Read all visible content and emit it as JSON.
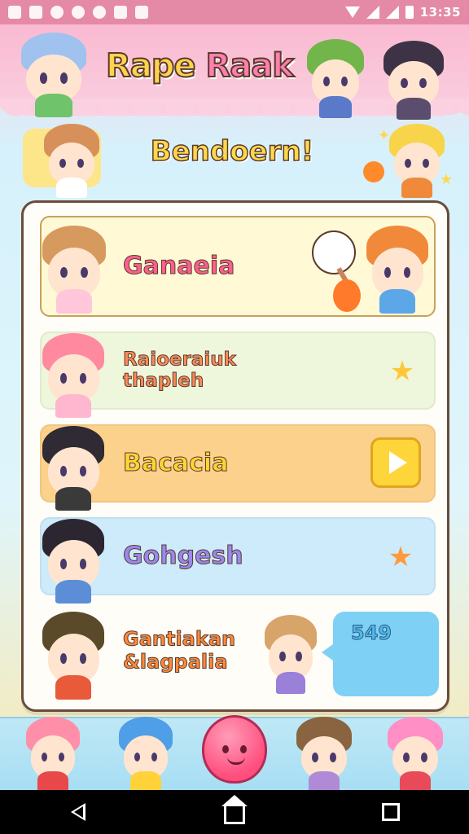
{
  "status_bar": {
    "time": "13:35",
    "icons": [
      "image-icon",
      "notification-icon",
      "alert-icon",
      "compass-icon",
      "record-icon",
      "usb-icon",
      "accessibility-icon",
      "wifi-icon",
      "signal-icon",
      "battery-icon"
    ]
  },
  "header": {
    "title_parts": [
      "Rape",
      " ",
      "Raak"
    ]
  },
  "banner": {
    "title": "Bendoern!"
  },
  "list": {
    "items": [
      {
        "label_line1": "Ganaeia",
        "label_line2": "",
        "accessory": "microphone-icon"
      },
      {
        "label_line1": "Raioeraiuk",
        "label_line2": "thapleh",
        "accessory": "star-icon"
      },
      {
        "label_line1": "Bacacia",
        "label_line2": "",
        "accessory": "play-button"
      },
      {
        "label_line1": "Gohgesh",
        "label_line2": "",
        "accessory": "star-icon"
      },
      {
        "label_line1": "Gantiakan",
        "label_line2": "&lagpalia",
        "accessory": "score-box",
        "score": "549"
      }
    ]
  },
  "colors": {
    "status_bar": "#e58aa6",
    "header_pink": "#f9b9d1",
    "panel_border": "#6b4b3a",
    "row_yellow": "#fff9d6",
    "row_green": "#eef7dc",
    "row_orange": "#fcd18c",
    "row_blue": "#cdebfa",
    "score_blue": "#7fd0f5",
    "play_yellow": "#ffd63a",
    "bottom_bar": "#bfe8f6"
  },
  "nav": {
    "buttons": [
      "back-icon",
      "home-icon",
      "recent-apps-icon"
    ]
  }
}
